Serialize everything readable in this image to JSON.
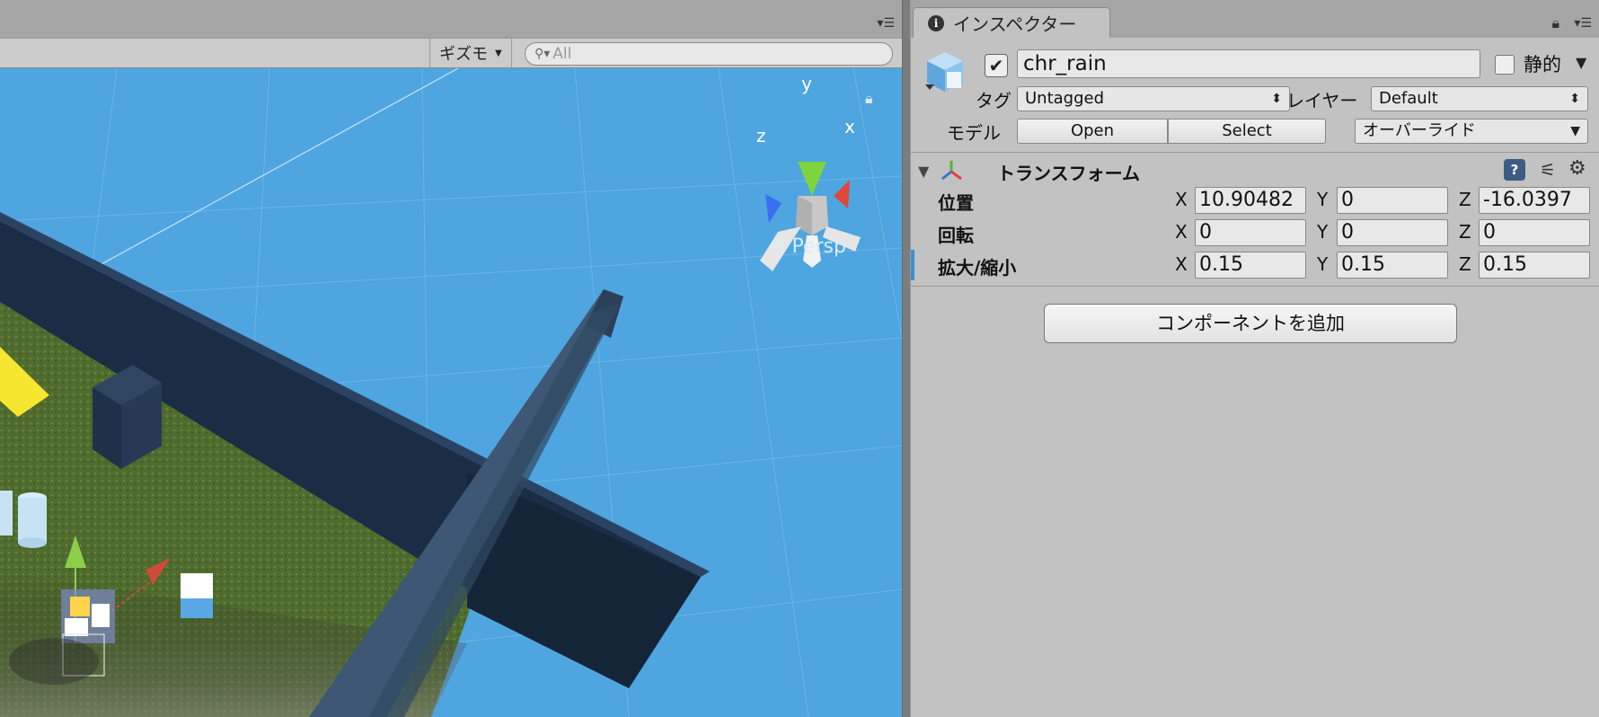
{
  "scene": {
    "gizmo_label": "ギズモ",
    "search_placeholder": "All",
    "persp_label": "Persp",
    "axis_labels": {
      "x": "x",
      "y": "y",
      "z": "z"
    }
  },
  "inspector": {
    "tab_label": "インスペクター",
    "object_name": "chr_rain",
    "active_checked": true,
    "static_label": "静的",
    "static_checked": false,
    "tag_label": "タグ",
    "tag_value": "Untagged",
    "layer_label": "レイヤー",
    "layer_value": "Default",
    "model_label": "モデル",
    "open_button": "Open",
    "select_button": "Select",
    "override_label": "オーバーライド",
    "transform": {
      "title": "トランスフォーム",
      "position": {
        "label": "位置",
        "x": "10.90482",
        "y": "0",
        "z": "-16.0397"
      },
      "rotation": {
        "label": "回転",
        "x": "0",
        "y": "0",
        "z": "0"
      },
      "scale": {
        "label": "拡大/縮小",
        "x": "0.15",
        "y": "0.15",
        "z": "0.15"
      }
    },
    "axis_x": "X",
    "axis_y": "Y",
    "axis_z": "Z",
    "add_component_button": "コンポーネントを追加"
  },
  "colors": {
    "sky": "#4ea5e0",
    "wall": "#1e3047",
    "ground": "#4e6a2d",
    "accent_blue": "#3a8fd8"
  },
  "icons": {
    "scene_menu": "panel-menu-icon",
    "lock": "lock-icon",
    "info": "info-icon",
    "gear": "gear-icon",
    "help": "help-icon"
  }
}
